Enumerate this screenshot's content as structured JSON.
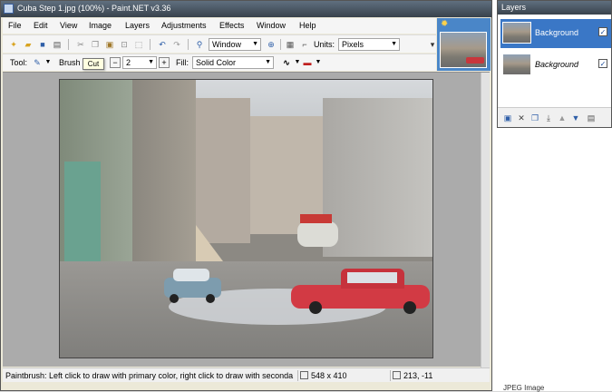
{
  "window": {
    "title": "Cuba Step 1.jpg (100%) - Paint.NET v3.36"
  },
  "menu": [
    "File",
    "Edit",
    "View",
    "Image",
    "Layers",
    "Adjustments",
    "Effects",
    "Window",
    "Help"
  ],
  "toolbar": {
    "zoom_combo": "Window",
    "units_label": "Units:",
    "units_value": "Pixels",
    "tool_label": "Tool:",
    "brush_label": "Brush",
    "brush_width": "2",
    "fill_label": "Fill:",
    "fill_value": "Solid Color",
    "tooltip": "Cut"
  },
  "icons": {
    "new": "new-file-icon",
    "open": "open-folder-icon",
    "save": "save-icon",
    "print": "print-icon",
    "cut": "cut-icon",
    "copy": "copy-icon",
    "paste": "paste-icon",
    "undo": "undo-icon",
    "redo": "redo-icon",
    "zoom": "zoom-icon",
    "grid": "grid-icon",
    "rulers": "rulers-icon"
  },
  "status": {
    "message": "Paintbrush: Left click to draw with primary color, right click to draw with seconda",
    "image_size": "548 x 410",
    "cursor": "213, -11"
  },
  "layers": {
    "title": "Layers",
    "items": [
      {
        "name": "Background",
        "visible": true,
        "selected": true
      },
      {
        "name": "Background",
        "visible": true,
        "selected": false
      }
    ]
  },
  "behind_window_text": "JPEG Image",
  "colors": {
    "selection": "#3a77c6",
    "titlebar": "#4a5560",
    "canvas_bg": "#ababab"
  }
}
